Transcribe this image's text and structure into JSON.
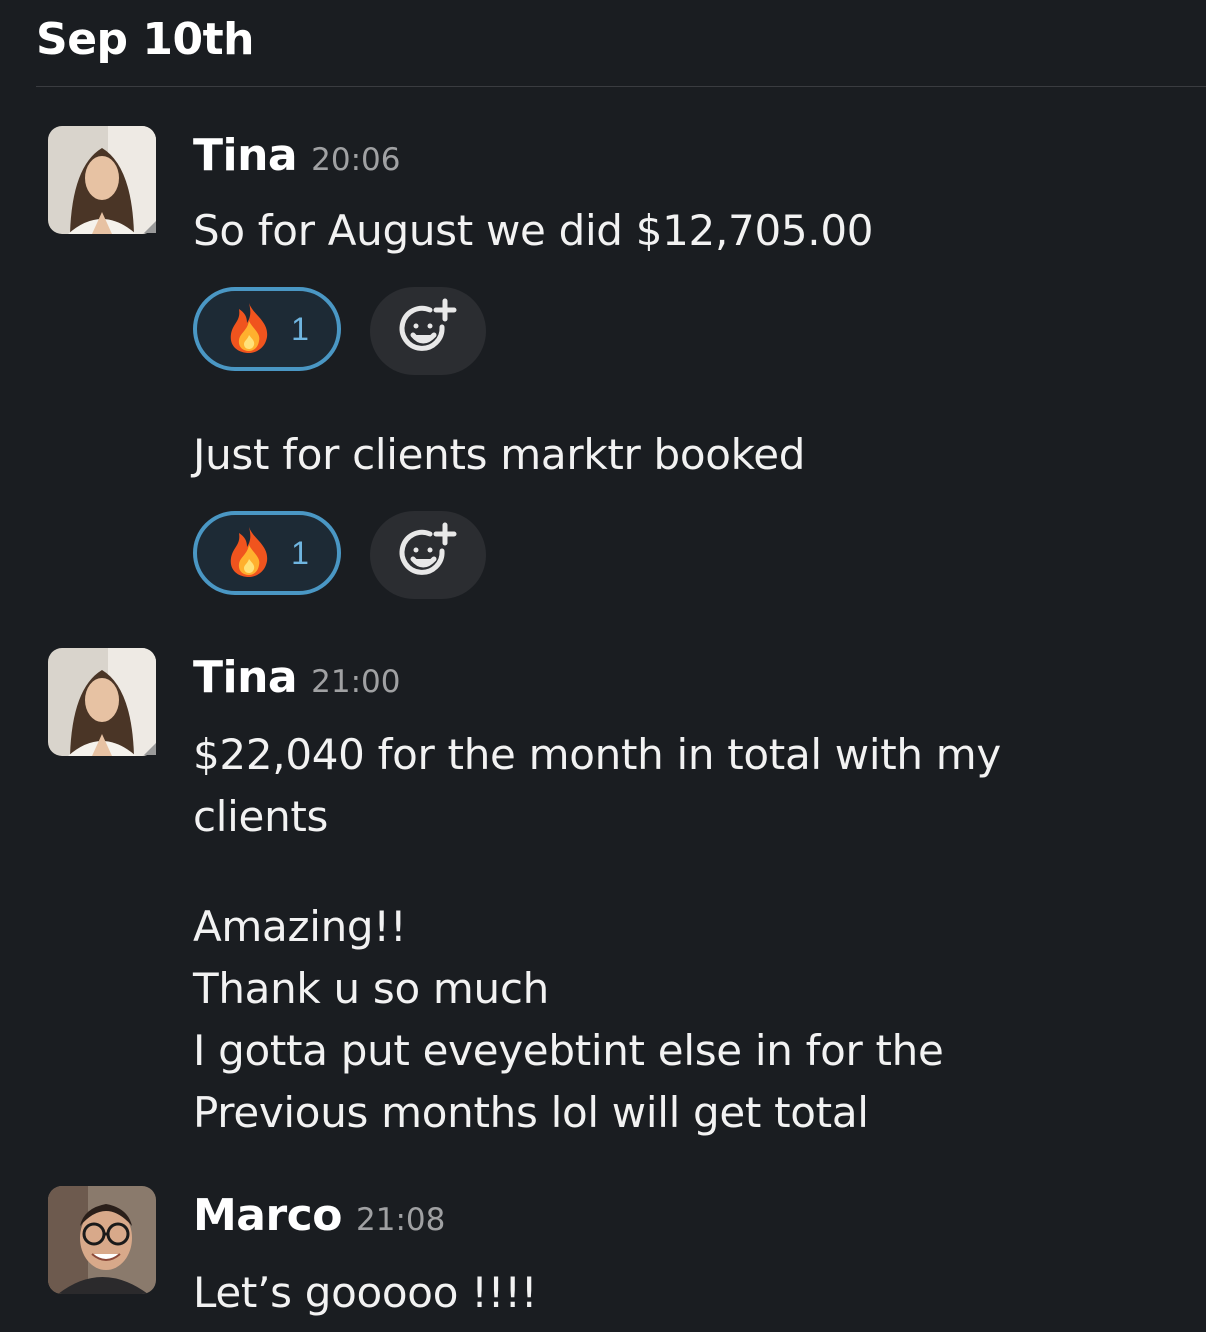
{
  "date_header": "Sep 10th",
  "messages": [
    {
      "author": "Tina",
      "time": "20:06",
      "lines": [
        "So for August we did $12,705.00"
      ],
      "reaction": {
        "icon": "fire-emoji-icon",
        "count": "1"
      }
    },
    {
      "lines": [
        "Just for clients marktr booked"
      ],
      "reaction": {
        "icon": "fire-emoji-icon",
        "count": "1"
      }
    },
    {
      "author": "Tina",
      "time": "21:00",
      "lines": [
        "$22,040 for the month in total with my",
        "clients",
        "",
        "Amazing!!",
        "Thank u so much",
        "I gotta put eveyebtint else in for the",
        "Previous months lol will get total"
      ]
    },
    {
      "author": "Marco",
      "time": "21:08",
      "lines": [
        "Let’s gooooo !!!!"
      ]
    }
  ],
  "colors": {
    "background": "#1a1d21",
    "reaction_border": "#4a97c4",
    "reaction_count": "#6fb5e0"
  }
}
